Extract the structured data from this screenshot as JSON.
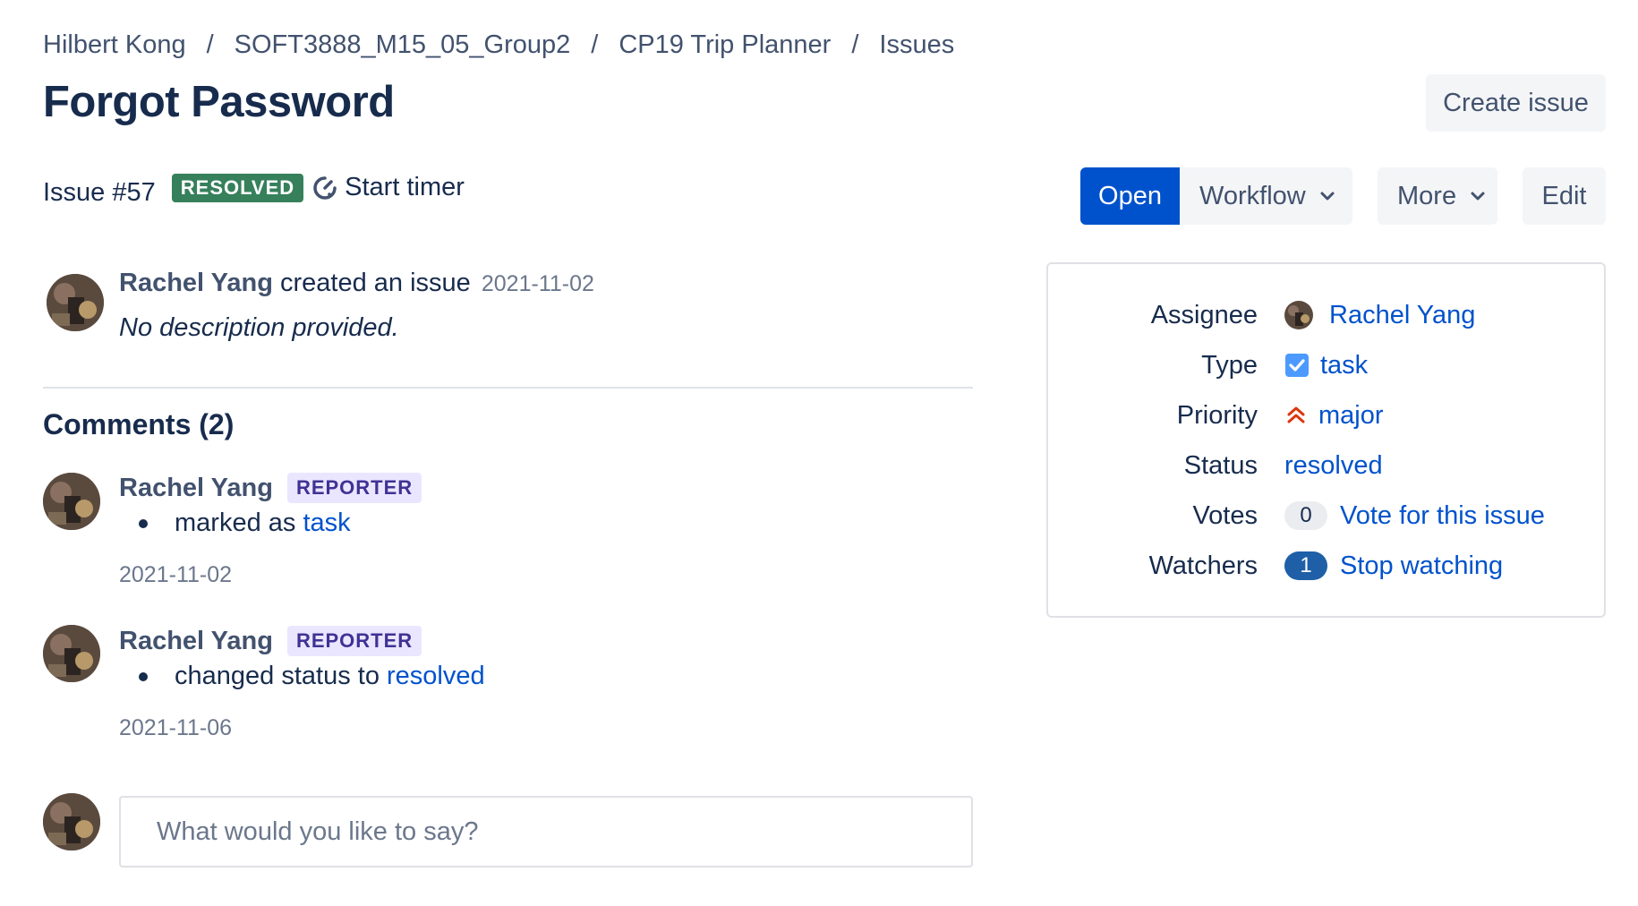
{
  "breadcrumb": [
    "Hilbert Kong",
    "SOFT3888_M15_05_Group2",
    "CP19 Trip Planner",
    "Issues"
  ],
  "breadcrumb_separator": "/",
  "page_title": "Forgot Password",
  "header": {
    "create_issue_label": "Create issue"
  },
  "issue": {
    "number_label": "Issue #57",
    "status_lozenge": "RESOLVED",
    "start_timer_label": "Start timer"
  },
  "actions": {
    "open_label": "Open",
    "workflow_label": "Workflow",
    "more_label": "More",
    "edit_label": "Edit"
  },
  "activity": {
    "author": "Rachel Yang",
    "action": "created an issue",
    "date": "2021-11-02",
    "description": "No description provided."
  },
  "comments": {
    "title": "Comments (2)",
    "items": [
      {
        "author": "Rachel Yang",
        "role": "REPORTER",
        "prefix": "marked as",
        "value": "task",
        "date": "2021-11-02"
      },
      {
        "author": "Rachel Yang",
        "role": "REPORTER",
        "prefix": "changed status to",
        "value": "resolved",
        "date": "2021-11-06"
      }
    ],
    "input_placeholder": "What would you like to say?"
  },
  "properties": {
    "assignee_label": "Assignee",
    "assignee_value": "Rachel Yang",
    "type_label": "Type",
    "type_value": "task",
    "priority_label": "Priority",
    "priority_value": "major",
    "status_label": "Status",
    "status_value": "resolved",
    "votes_label": "Votes",
    "votes_count": "0",
    "votes_action": "Vote for this issue",
    "watchers_label": "Watchers",
    "watchers_count": "1",
    "watchers_action": "Stop watching"
  },
  "colors": {
    "primary": "#0052cc",
    "resolved_green": "#36805b",
    "reporter_badge_bg": "#eae6ff",
    "reporter_badge_text": "#403294",
    "priority_red": "#de350b",
    "task_blue": "#4c9aff"
  },
  "icons": [
    "timer-icon",
    "chevron-down-icon",
    "task-checkbox-icon",
    "priority-major-icon",
    "avatar"
  ]
}
